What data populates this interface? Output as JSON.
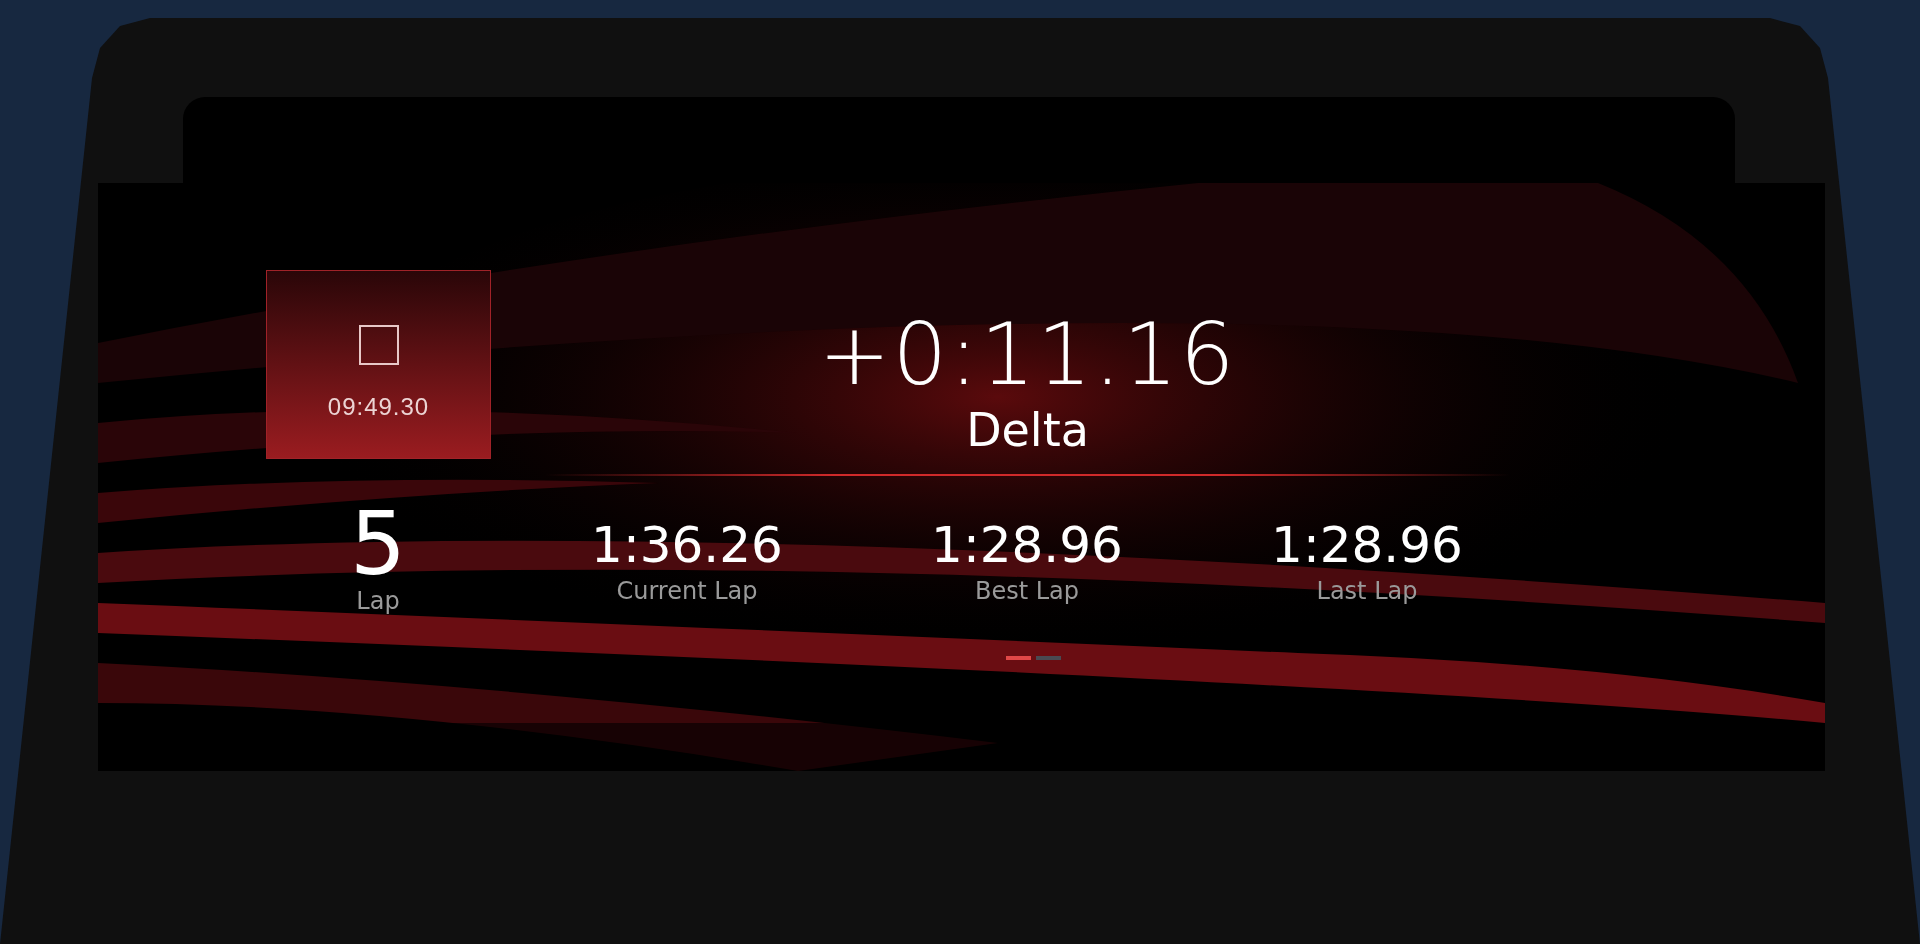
{
  "stop_button": {
    "time": "09:49.30"
  },
  "delta": {
    "value": "+0:11.16",
    "label": "Delta"
  },
  "stats": [
    {
      "kind": "lap",
      "value": "5",
      "label": "Lap"
    },
    {
      "kind": "time",
      "value": "1:36.26",
      "label": "Current Lap"
    },
    {
      "kind": "time",
      "value": "1:28.96",
      "label": "Best Lap"
    },
    {
      "kind": "time",
      "value": "1:28.96",
      "label": "Last Lap"
    }
  ],
  "pages": [
    {
      "selected": true
    },
    {
      "selected": false
    }
  ]
}
